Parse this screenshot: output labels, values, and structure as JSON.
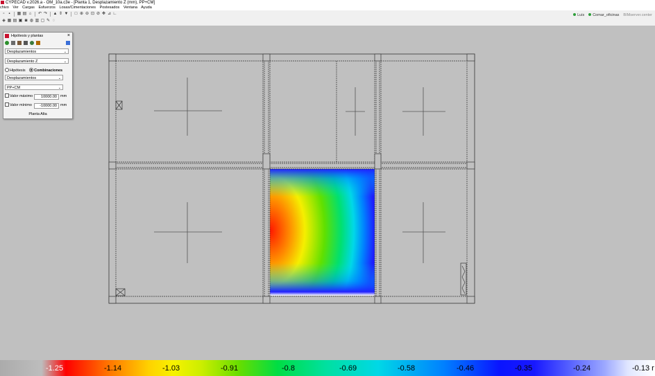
{
  "window": {
    "title": "CYPECAD v.2026.a - OM_10a.c3e - [Planta 1, Desplazamiento Z (mm), PP+CM]"
  },
  "menu": [
    "chivo",
    "Ver",
    "Cargas",
    "Esfuerzos",
    "Losas/Cimentaciones",
    "Postesados",
    "Ventana",
    "Ayuda"
  ],
  "toolbar": {
    "user": "Luis",
    "company": "Comar_oficinas",
    "server": "BIMserver.center"
  },
  "panel": {
    "title": "Hipótesis y plantas",
    "close": "×",
    "select_result_type": "Desplazamientos",
    "select_component": "Desplazamiento Z",
    "radio_hypothesis": "Hipótesis",
    "radio_combinations": "Combinaciones",
    "select_group": "Desplazamientos",
    "select_combination": "PP+CM",
    "max_label": "Valor máximo",
    "max_value": "10000.00",
    "min_label": "Valor mínimo",
    "min_value": "-10000.00",
    "unit": "mm",
    "floor": "Planta Alta"
  },
  "legend": {
    "values": [
      "-1.25",
      "-1.14",
      "-1.03",
      "-0.91",
      "-0.8",
      "-0.69",
      "-0.58",
      "-0.46",
      "-0.35",
      "-0.24",
      "-0.13 r"
    ]
  },
  "colors": {
    "canvas": "#c0c0c0",
    "toolbar": "#f0f0f0",
    "accent_app": "#c8102e"
  }
}
